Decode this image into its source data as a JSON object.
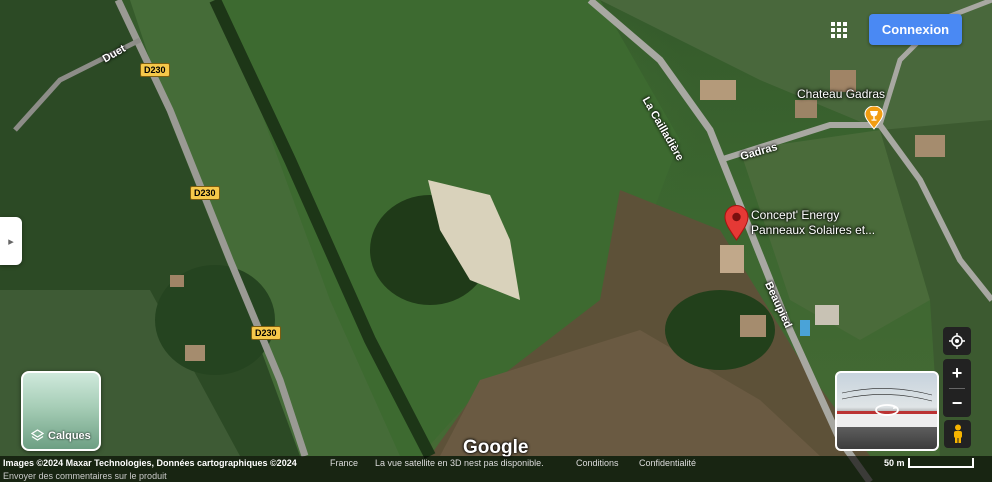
{
  "header": {
    "login_label": "Connexion"
  },
  "labels": {
    "road_duet": "Duet",
    "road_cailladiere": "La Cailladière",
    "road_gadras": "Gadras",
    "road_beaupied": "Beaupied",
    "shield_1": "D230",
    "shield_2": "D230",
    "shield_3": "D230",
    "place_chateau": "Chateau Gadras",
    "place_concept_line1": "Concept' Energy",
    "place_concept_line2": "Panneaux Solaires et..."
  },
  "map_controls": {
    "layers_label": "Calques",
    "zoom_in": "+",
    "zoom_out": "−"
  },
  "logo": "Google",
  "footer": {
    "attribution": "Images ©2024 Maxar Technologies, Données cartographiques ©2024",
    "country": "France",
    "notice": "La vue satellite en 3D nest pas disponible.",
    "terms": "Conditions",
    "privacy": "Confidentialité",
    "scale": "50 m",
    "feedback": "Envoyer des commentaires sur le produit"
  },
  "colors": {
    "accent": "#4a89f3",
    "pin": "#e53935",
    "poi": "#f29d12"
  }
}
